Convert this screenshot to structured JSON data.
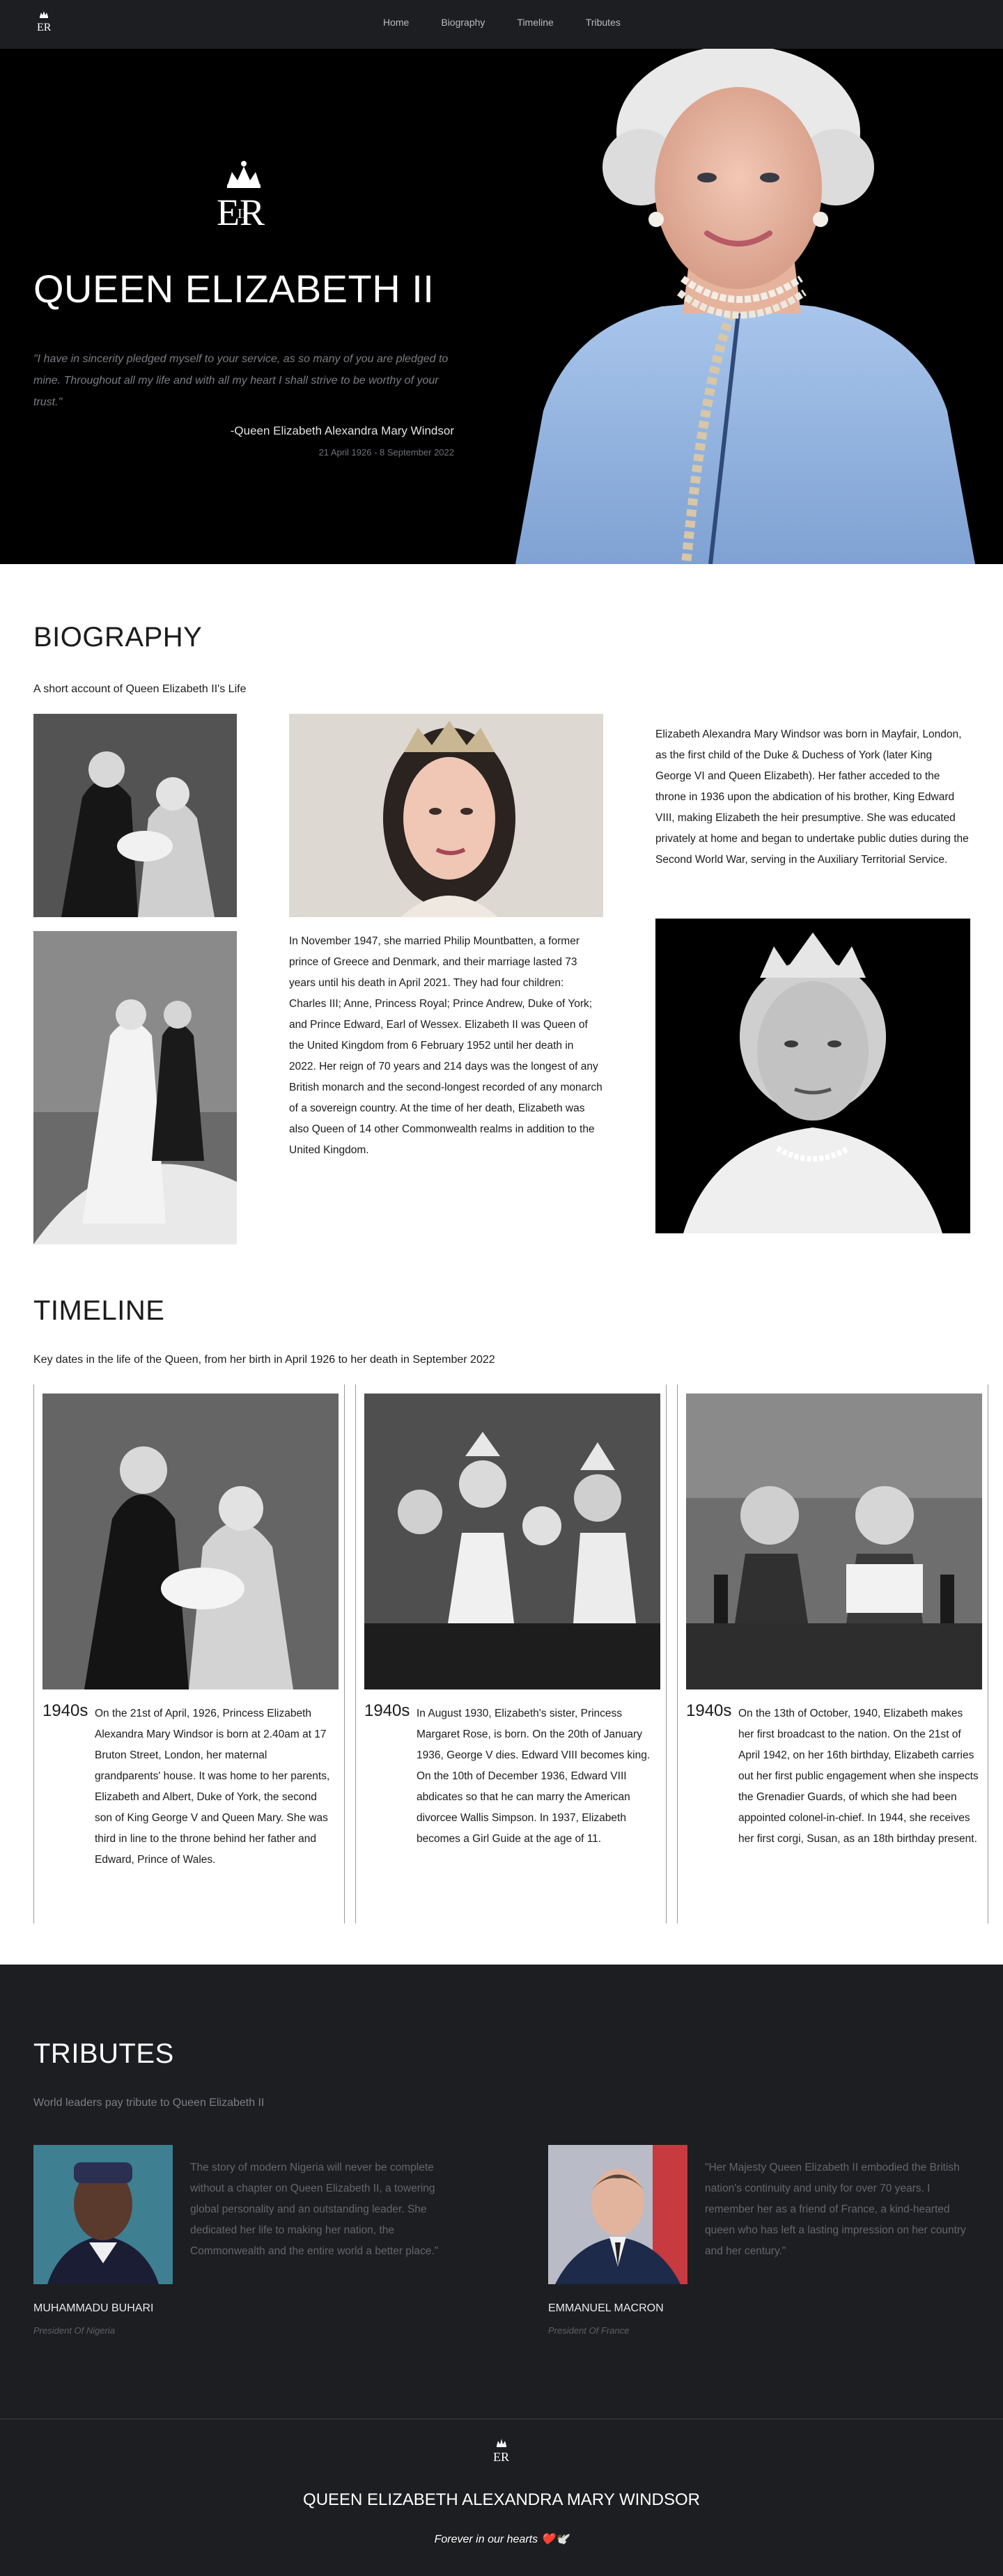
{
  "nav": {
    "links": [
      "Home",
      "Biography",
      "Timeline",
      "Tributes"
    ]
  },
  "hero": {
    "title": "QUEEN ELIZABETH II",
    "quote": "\"I have in sincerity pledged myself to your service, as so many of you are pledged to mine. Throughout all my life and with all my heart I shall strive to be worthy of your trust.\"",
    "author": "-Queen Elizabeth Alexandra Mary Windsor",
    "dates": "21 April 1926 - 8 September 2022"
  },
  "biography": {
    "title": "BIOGRAPHY",
    "subtitle": "A short account of Queen Elizabeth II's Life",
    "paragraph_1": "Elizabeth Alexandra Mary Windsor was born in Mayfair, London, as the first child of the Duke & Duchess of York (later King George VI and Queen Elizabeth). Her father acceded to the throne in 1936 upon the abdication of his brother, King Edward VIII, making Elizabeth the heir presumptive. She was educated privately at home and began to undertake public duties during the Second World War, serving in the Auxiliary Territorial Service.",
    "paragraph_2": "In November 1947, she married Philip Mountbatten, a former prince of Greece and Denmark, and their marriage lasted 73 years until his death in April 2021. They had four children: Charles III; Anne, Princess Royal; Prince Andrew, Duke of York; and Prince Edward, Earl of Wessex. Elizabeth II was Queen of the United Kingdom from 6 February 1952 until her death in 2022. Her reign of 70 years and 214 days was the longest of any British monarch and the second-longest recorded of any monarch of a sovereign country. At the time of her death, Elizabeth was also Queen of 14 other Commonwealth realms in addition to the United Kingdom."
  },
  "timeline": {
    "title": "TIMELINE",
    "subtitle": "Key dates in the life of the Queen, from her birth in April 1926 to her death in September 2022",
    "items": [
      {
        "decade": "1940s",
        "text": "On the 21st of April, 1926, Princess Elizabeth Alexandra Mary Windsor is born at 2.40am at 17 Bruton Street, London, her maternal grandparents' house. It was home to her parents, Elizabeth and Albert, Duke of York, the second son of King George V and Queen Mary. She was third in line to the throne behind her father and Edward, Prince of Wales."
      },
      {
        "decade": "1940s",
        "text": "In August 1930, Elizabeth's sister, Princess Margaret Rose, is born. On the 20th of January 1936, George V dies. Edward VIII becomes king. On the 10th of December 1936, Edward VIII abdicates so that he can marry the American divorcee Wallis Simpson. In 1937, Elizabeth becomes a Girl Guide at the age of 11."
      },
      {
        "decade": "1940s",
        "text": "On the 13th of October, 1940, Elizabeth makes her first broadcast to the nation. On the 21st of April 1942, on her 16th birthday, Elizabeth carries out her first public engagement when she inspects the Grenadier Guards, of which she had been appointed colonel-in-chief. In 1944, she receives her first corgi, Susan, as an 18th birthday present."
      }
    ]
  },
  "tributes": {
    "title": "TRIBUTES",
    "subtitle": "World leaders pay tribute to Queen Elizabeth II",
    "items": [
      {
        "quote": "The story of modern Nigeria will never be complete without a chapter on Queen Elizabeth II, a towering global personality and an outstanding leader. She dedicated her life to making her nation, the Commonwealth and the entire world a better place.\"",
        "name": "MUHAMMADU BUHARI",
        "role": "President Of Nigeria"
      },
      {
        "quote": "\"Her Majesty Queen Elizabeth II embodied the British nation's continuity and unity for over 70 years. I remember her as a friend of France, a kind-hearted queen who has left a lasting impression on her country and her century.\"",
        "name": "EMMANUEL MACRON",
        "role": "President Of France"
      }
    ]
  },
  "footer": {
    "name": "QUEEN ELIZABETH ALEXANDRA MARY WINDSOR",
    "tagline": "Forever in our hearts",
    "emoji": "❤️🕊️"
  }
}
